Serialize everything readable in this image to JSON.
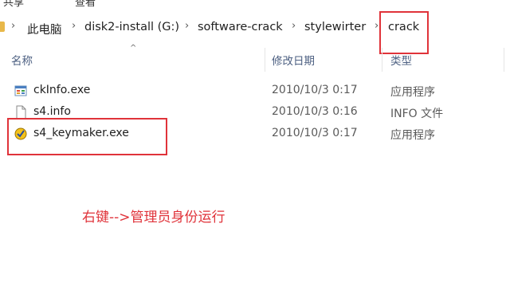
{
  "menu": {
    "partial_label": "共享",
    "partial_label_2": "查看"
  },
  "breadcrumb": {
    "items": [
      "此电脑",
      "disk2-install (G:)",
      "software-crack",
      "stylewirter",
      "crack"
    ]
  },
  "columns": {
    "name": "名称",
    "date": "修改日期",
    "type": "类型"
  },
  "files": [
    {
      "name": "ckInfo.exe",
      "date": "2010/10/3 0:17",
      "type": "应用程序",
      "icon": "exe-window-icon"
    },
    {
      "name": "s4.info",
      "date": "2010/10/3 0:16",
      "type": "INFO 文件",
      "icon": "document-icon"
    },
    {
      "name": "s4_keymaker.exe",
      "date": "2010/10/3 0:17",
      "type": "应用程序",
      "icon": "keymaker-app-icon"
    }
  ],
  "annotation": {
    "text": "右键-->管理员身份运行"
  },
  "colors": {
    "highlight": "#e0333a",
    "header_text": "#4d6082"
  }
}
